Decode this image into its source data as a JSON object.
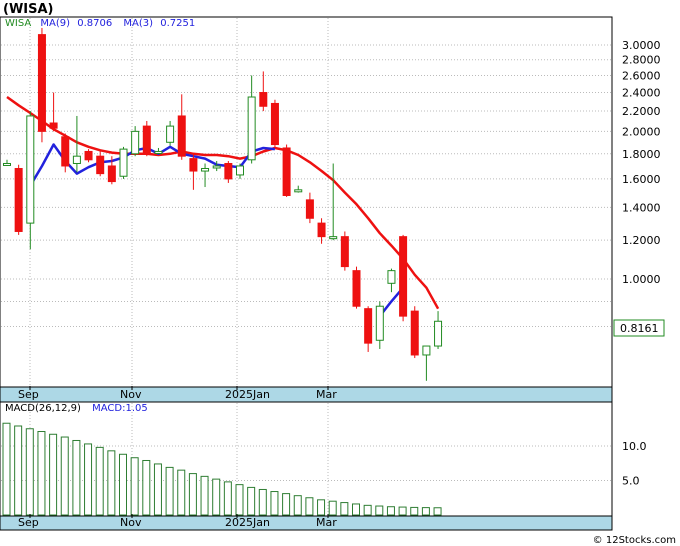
{
  "header": {
    "ticker": "(WISA)"
  },
  "price_panel": {
    "legend": {
      "symbol": "WISA",
      "ma9_label": "MA(9)",
      "ma9_value": "0.8706",
      "ma3_label": "MA(3)",
      "ma3_value": "0.7251"
    },
    "last_price_label": "0.8161"
  },
  "macd_panel": {
    "legend": {
      "params": "MACD(26,12,9)",
      "value_label": "MACD:1.05"
    }
  },
  "x_axis_labels": [
    "Sep",
    "Nov",
    "2025Jan",
    "Mar"
  ],
  "watermark": "© 12Stocks.com",
  "colors": {
    "up": "#228b22",
    "down": "#ee1111",
    "ma_fast": "#2222dd",
    "ma_slow": "#ee1111",
    "axis_band": "#add8e6",
    "grid": "#bbbbbb",
    "macd_bar": "#2e7d32"
  },
  "chart_data": [
    {
      "type": "candlestick",
      "title": "(WISA)",
      "scale": "log",
      "ylim": [
        0.7,
        3.2
      ],
      "y_ticks": [
        1.0,
        1.2,
        1.4,
        1.6,
        1.8,
        2.0,
        2.2,
        2.4,
        2.6,
        2.8,
        3.0
      ],
      "y_tick_labels": [
        "1.0000",
        "1.2000",
        "1.4000",
        "1.6000",
        "1.8000",
        "2.0000",
        "2.2000",
        "2.4000",
        "2.6000",
        "2.8000",
        "3.0000"
      ],
      "x_labels": [
        "Sep",
        "Nov",
        "2025Jan",
        "Mar"
      ],
      "grid": true,
      "candles": [
        {
          "o": 1.72,
          "h": 1.75,
          "l": 1.7,
          "c": 1.72
        },
        {
          "o": 1.68,
          "h": 1.71,
          "l": 1.23,
          "c": 1.25
        },
        {
          "o": 1.3,
          "h": 2.2,
          "l": 1.15,
          "c": 2.15
        },
        {
          "o": 3.15,
          "h": 3.25,
          "l": 1.9,
          "c": 2.0
        },
        {
          "o": 2.08,
          "h": 2.4,
          "l": 2.0,
          "c": 2.03
        },
        {
          "o": 1.95,
          "h": 1.98,
          "l": 1.65,
          "c": 1.7
        },
        {
          "o": 1.72,
          "h": 2.15,
          "l": 1.65,
          "c": 1.78
        },
        {
          "o": 1.82,
          "h": 1.84,
          "l": 1.73,
          "c": 1.75
        },
        {
          "o": 1.78,
          "h": 1.82,
          "l": 1.62,
          "c": 1.64
        },
        {
          "o": 1.7,
          "h": 1.78,
          "l": 1.56,
          "c": 1.58
        },
        {
          "o": 1.62,
          "h": 1.86,
          "l": 1.6,
          "c": 1.84
        },
        {
          "o": 1.8,
          "h": 2.05,
          "l": 1.78,
          "c": 2.0
        },
        {
          "o": 2.05,
          "h": 2.1,
          "l": 1.78,
          "c": 1.8
        },
        {
          "o": 1.82,
          "h": 1.85,
          "l": 1.8,
          "c": 1.82
        },
        {
          "o": 1.9,
          "h": 2.1,
          "l": 1.87,
          "c": 2.05
        },
        {
          "o": 2.15,
          "h": 2.38,
          "l": 1.75,
          "c": 1.78
        },
        {
          "o": 1.76,
          "h": 1.8,
          "l": 1.52,
          "c": 1.66
        },
        {
          "o": 1.66,
          "h": 1.72,
          "l": 1.54,
          "c": 1.68
        },
        {
          "o": 1.7,
          "h": 1.74,
          "l": 1.66,
          "c": 1.7
        },
        {
          "o": 1.72,
          "h": 1.74,
          "l": 1.57,
          "c": 1.6
        },
        {
          "o": 1.63,
          "h": 1.72,
          "l": 1.6,
          "c": 1.7
        },
        {
          "o": 1.75,
          "h": 2.6,
          "l": 1.72,
          "c": 2.35
        },
        {
          "o": 2.4,
          "h": 2.65,
          "l": 2.2,
          "c": 2.25
        },
        {
          "o": 2.28,
          "h": 2.32,
          "l": 1.85,
          "c": 1.88
        },
        {
          "o": 1.85,
          "h": 1.88,
          "l": 1.47,
          "c": 1.48
        },
        {
          "o": 1.52,
          "h": 1.55,
          "l": 1.5,
          "c": 1.52
        },
        {
          "o": 1.45,
          "h": 1.5,
          "l": 1.3,
          "c": 1.33
        },
        {
          "o": 1.3,
          "h": 1.33,
          "l": 1.18,
          "c": 1.22
        },
        {
          "o": 1.21,
          "h": 1.72,
          "l": 1.2,
          "c": 1.22
        },
        {
          "o": 1.22,
          "h": 1.25,
          "l": 1.04,
          "c": 1.06
        },
        {
          "o": 1.04,
          "h": 1.06,
          "l": 0.87,
          "c": 0.88
        },
        {
          "o": 0.87,
          "h": 0.88,
          "l": 0.71,
          "c": 0.74
        },
        {
          "o": 0.75,
          "h": 0.9,
          "l": 0.72,
          "c": 0.88
        },
        {
          "o": 0.98,
          "h": 1.05,
          "l": 0.94,
          "c": 1.04
        },
        {
          "o": 1.22,
          "h": 1.23,
          "l": 0.82,
          "c": 0.84
        },
        {
          "o": 0.86,
          "h": 0.88,
          "l": 0.69,
          "c": 0.7
        },
        {
          "o": 0.7,
          "h": 0.73,
          "l": 0.62,
          "c": 0.73
        },
        {
          "o": 0.73,
          "h": 0.86,
          "l": 0.72,
          "c": 0.82
        }
      ],
      "series": [
        {
          "name": "MA(9)",
          "values": [
            2.35,
            2.26,
            2.18,
            2.1,
            2.02,
            1.96,
            1.9,
            1.86,
            1.83,
            1.81,
            1.8,
            1.8,
            1.8,
            1.79,
            1.8,
            1.82,
            1.8,
            1.79,
            1.79,
            1.78,
            1.76,
            1.78,
            1.82,
            1.85,
            1.83,
            1.79,
            1.73,
            1.66,
            1.59,
            1.5,
            1.42,
            1.33,
            1.24,
            1.17,
            1.1,
            1.02,
            0.96,
            0.87
          ]
        },
        {
          "name": "MA(3)",
          "values": [
            null,
            null,
            1.55,
            1.7,
            1.88,
            1.74,
            1.64,
            1.69,
            1.73,
            1.74,
            1.77,
            1.83,
            1.85,
            1.8,
            1.86,
            1.8,
            1.78,
            1.76,
            1.71,
            1.7,
            1.69,
            1.82,
            1.85,
            1.84,
            null,
            null,
            null,
            null,
            null,
            null,
            null,
            null,
            0.84,
            0.9,
            0.96,
            null,
            null,
            null
          ]
        }
      ]
    },
    {
      "type": "bar",
      "title": "MACD(26,12,9)",
      "ylim": [
        0,
        14
      ],
      "y_ticks": [
        5.0,
        10.0
      ],
      "y_tick_labels": [
        "5.0",
        "10.0"
      ],
      "values": [
        13.3,
        12.9,
        12.5,
        12.1,
        11.7,
        11.3,
        10.8,
        10.3,
        9.8,
        9.3,
        8.8,
        8.3,
        7.9,
        7.4,
        6.9,
        6.5,
        6.0,
        5.6,
        5.2,
        4.8,
        4.4,
        4.0,
        3.7,
        3.4,
        3.1,
        2.8,
        2.5,
        2.2,
        2.0,
        1.8,
        1.6,
        1.4,
        1.3,
        1.2,
        1.15,
        1.1,
        1.07,
        1.05
      ],
      "current_value": 1.05
    }
  ]
}
